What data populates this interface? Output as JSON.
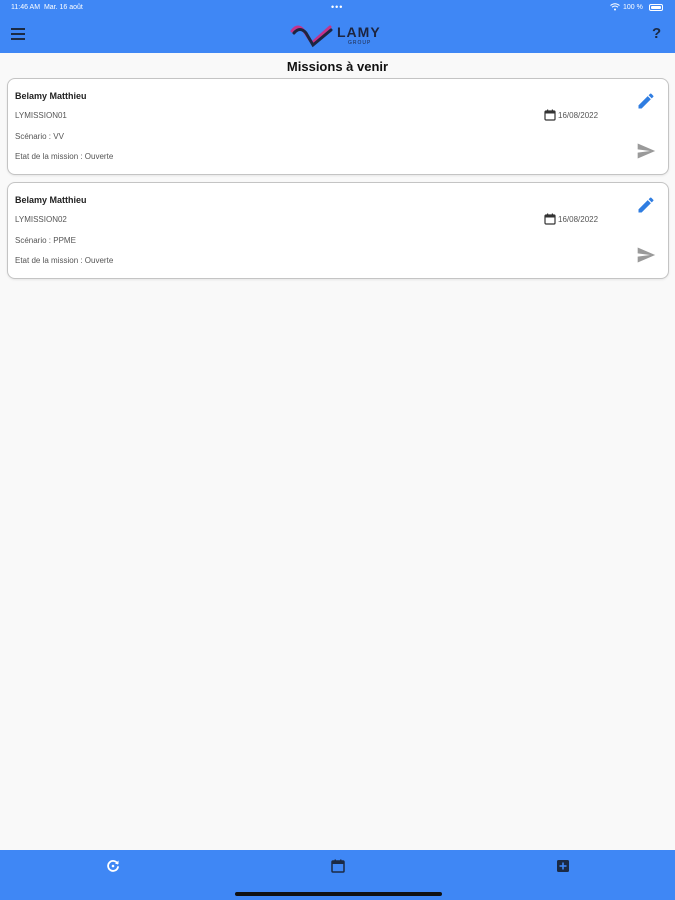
{
  "status_bar": {
    "time": "11:46 AM",
    "date": "Mar. 16 août",
    "dots": "•••",
    "battery_pct": "100 %"
  },
  "header": {
    "brand": "LAMY",
    "brand_sub": "GROUP",
    "help_label": "?",
    "accent_color": "#3f87f5"
  },
  "page": {
    "title": "Missions à venir"
  },
  "missions": [
    {
      "name": "Belamy Matthieu",
      "code": "LYMISSION01",
      "date": "16/08/2022",
      "scenario": "Scénario : VV",
      "state": "Etat de la mission : Ouverte"
    },
    {
      "name": "Belamy Matthieu",
      "code": "LYMISSION02",
      "date": "16/08/2022",
      "scenario": "Scénario : PPME",
      "state": "Etat de la mission : Ouverte"
    }
  ],
  "icons": {
    "menu": "menu-icon",
    "edit": "pencil-icon",
    "send": "send-icon",
    "calendar": "calendar-icon",
    "refresh": "refresh-icon",
    "tab_calendar": "calendar-icon",
    "tab_add": "add-box-icon"
  }
}
